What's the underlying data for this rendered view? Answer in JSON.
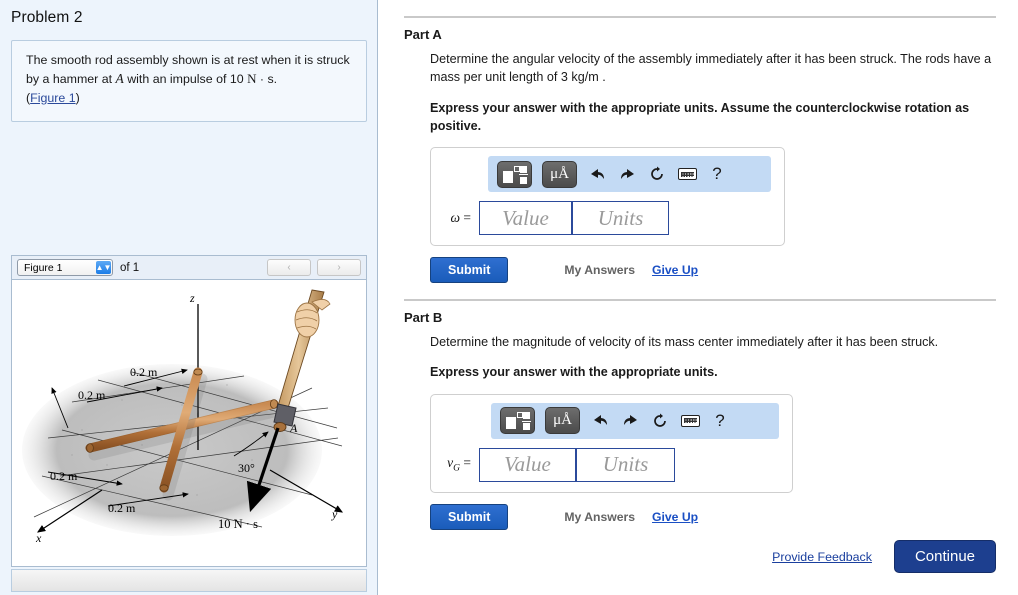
{
  "left": {
    "problem_title": "Problem 2",
    "problem_statement_1": "The smooth rod assembly shown is at rest when it is struck by a hammer at ",
    "problem_var_A": "A",
    "problem_statement_2": " with an impulse of 10 ",
    "problem_unit_Ns": "N",
    "problem_dot_s": " · s.",
    "figure_link": "Figure 1",
    "figure_select_value": "Figure 1",
    "figure_of_label": "of 1",
    "nav_prev_icon": "chevron-left-icon",
    "nav_next_icon": "chevron-right-icon",
    "nav_prev_glyph": "‹",
    "nav_next_glyph": "›"
  },
  "figure": {
    "axis_z": "z",
    "axis_y": "y",
    "axis_x": "x",
    "point_label": "A",
    "angle_label": "30°",
    "impulse_label": "10 N · s",
    "dim_top_right": "0.2 m",
    "dim_top_left": "0.2 m",
    "dim_bottom_left": "0.2 m",
    "dim_bottom_right": "0.2 m"
  },
  "parts": [
    {
      "label": "Part A",
      "question": "Determine the angular velocity of the assembly immediately after it has been struck. The rods have a mass per unit length of 3 kg/m .",
      "instruction": "Express your answer with the appropriate units. Assume the counterclockwise rotation as positive.",
      "variable": "ω",
      "variable_sub": "",
      "value_placeholder": "Value",
      "units_placeholder": "Units",
      "submit_label": "Submit",
      "my_answers_label": "My Answers",
      "give_up_label": "Give Up"
    },
    {
      "label": "Part B",
      "question": "Determine the magnitude of velocity of its mass center immediately after it has been struck.",
      "instruction": "Express your answer with the appropriate units.",
      "variable": "v",
      "variable_sub": "G",
      "value_placeholder": "Value",
      "units_placeholder": "Units",
      "submit_label": "Submit",
      "my_answers_label": "My Answers",
      "give_up_label": "Give Up"
    }
  ],
  "toolbar": {
    "template_icon": "math-template-icon",
    "units_icon": "micro-angstrom-units-icon",
    "units_label": "μÅ",
    "undo_icon": "undo-arrow-icon",
    "redo_icon": "redo-arrow-icon",
    "reset_icon": "reset-circular-arrow-icon",
    "keyboard_icon": "keyboard-icon",
    "help_icon": "help-question-icon",
    "help_glyph": "?"
  },
  "footer": {
    "feedback_label": "Provide Feedback",
    "continue_label": "Continue"
  },
  "colors": {
    "panel_bg": "#edf4fc",
    "toolbar_bg": "#c3daf4",
    "submit_blue": "#1a5cba",
    "continue_blue": "#1d3f8f",
    "link_blue": "#1a4fc4",
    "rod_copper": "#b5763f"
  }
}
